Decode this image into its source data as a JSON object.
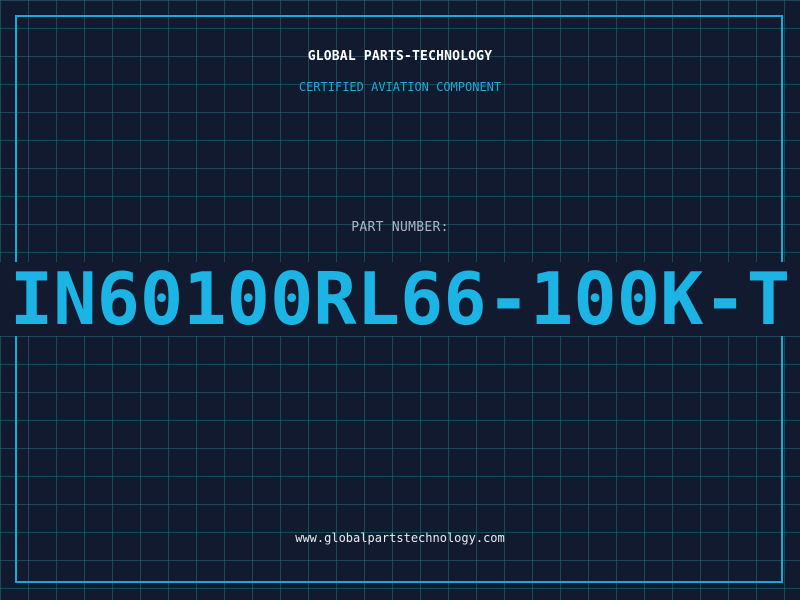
{
  "header": {
    "company": "GLOBAL PARTS-TECHNOLOGY",
    "subtitle": "CERTIFIED AVIATION COMPONENT"
  },
  "part": {
    "label": "PART NUMBER:",
    "number": "IN60100RL66-100K-T"
  },
  "footer": {
    "website": "www.globalpartstechnology.com"
  },
  "colors": {
    "background": "#111a2e",
    "grid": "#226d80",
    "accent": "#1cb4e4",
    "frame": "#1aa9d3",
    "label": "#aeb6c4",
    "text": "#ffffff"
  }
}
